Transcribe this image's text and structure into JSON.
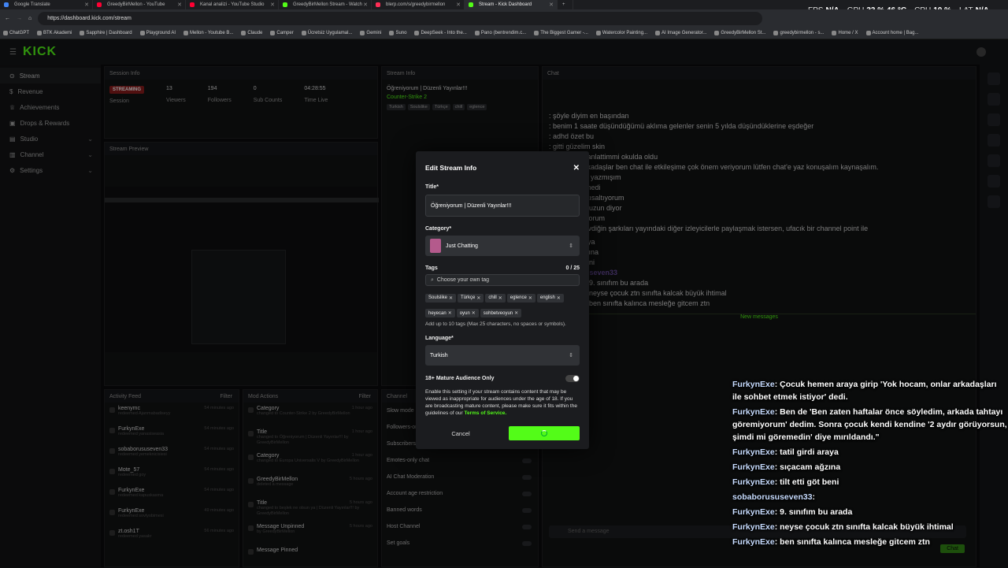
{
  "browser": {
    "tabs": [
      {
        "title": "Google Translate",
        "color": "#4285f4"
      },
      {
        "title": "GreedyBirMellon - YouTube",
        "color": "#ff0033"
      },
      {
        "title": "Kanal analizi - YouTube Studio",
        "color": "#ff0033"
      },
      {
        "title": "GreedyBirMellon Stream - Watch",
        "color": "#53fc18"
      },
      {
        "title": "blerp.com/s/greedybirmellon",
        "color": "#ff2d55"
      },
      {
        "title": "Stream - Kick Dashboard",
        "color": "#53fc18"
      }
    ],
    "url": "https://dashboard.kick.com/stream",
    "bookmarks": [
      "ChatGPT",
      "BTK Akademi",
      "Sapphire | Dashboard",
      "Playground AI",
      "Mellon - Youtube B...",
      "Claude",
      "Camper",
      "Ücretsiz Uygulamal...",
      "Gemini",
      "Suno",
      "DeepSeek - Into the...",
      "Pano (bentrendim.c...",
      "The Biggest Gamer -...",
      "Watercolor Painting...",
      "AI Image Generator...",
      "GreedyBirMellon St...",
      "greedybirmellon - s...",
      "Home / X",
      "Account home | Bag..."
    ]
  },
  "hud": {
    "fps_label": "FPS",
    "fps": "N/A",
    "gpu_label": "GPU",
    "gpu": "33 % 46 °C",
    "cpu_label": "CPU",
    "cpu": "10 %",
    "lat_label": "LAT",
    "lat": "N/A"
  },
  "sidebar": {
    "logo": "KICK",
    "items": [
      {
        "label": "Stream",
        "active": true
      },
      {
        "label": "Revenue"
      },
      {
        "label": "Achievements"
      },
      {
        "label": "Drops & Rewards"
      },
      {
        "label": "Studio",
        "expand": true
      },
      {
        "label": "Channel",
        "expand": true
      },
      {
        "label": "Settings",
        "expand": true
      }
    ]
  },
  "session": {
    "title": "Session Info",
    "status": "STREAMING",
    "viewers": "13",
    "followers": "194",
    "subs": "0",
    "time": "04:28:55",
    "labels": [
      "Session",
      "Viewers",
      "Followers",
      "Sub Counts",
      "Time Live"
    ]
  },
  "stream_info": {
    "title": "Stream Info",
    "stream_title": "Öğreniyorum | Düzenli Yayınlar!!!",
    "category": "Counter-Strike 2",
    "tags": [
      "Turkish",
      "Soulslike",
      "Türkçe",
      "chill",
      "eglence"
    ]
  },
  "preview": {
    "title": "Stream Preview"
  },
  "activity": {
    "title": "Activity Feed",
    "filter": "Filter",
    "items": [
      {
        "user": "keenymc",
        "text": "redeemed Ajanmabadiseyy",
        "time": "54 minutes ago"
      },
      {
        "user": "FurkynExe",
        "text": "redeemed yanasiseasia",
        "time": "54 minutes ago"
      },
      {
        "user": "sobaborususeven33",
        "text": "redeemed yemeknicisiesi",
        "time": "54 minutes ago"
      },
      {
        "user": "Mote_57",
        "text": "redeemed goy",
        "time": "54 minutes ago"
      },
      {
        "user": "FurkynExe",
        "text": "redeemed kapuskasma",
        "time": "54 minutes ago"
      },
      {
        "user": "FurkynExe",
        "text": "redeemed sovlyobimesi",
        "time": "49 minutes ago"
      },
      {
        "user": "zt.osh1T",
        "text": "redeemed yasakr",
        "time": "56 minutes ago"
      }
    ]
  },
  "mod_actions": {
    "title": "Mod Actions",
    "filter": "Filter",
    "items": [
      {
        "title": "Category",
        "text": "changed to Counter-Strike 2 by GreedyBirMellon",
        "time": "1 hour ago"
      },
      {
        "title": "Title",
        "text": "changed to Öğreniyorum | Düzenli Yayınlar!!! by GreedyBirMellon",
        "time": "1 hour ago"
      },
      {
        "title": "Category",
        "text": "changed to Europa Universalis V by GreedyBirMellon",
        "time": "1 hour ago"
      },
      {
        "title": "GreedyBirMellon",
        "text": "deleted a message",
        "time": "5 hours ago"
      },
      {
        "title": "Title",
        "text": "changed to beşlek ne olsun ya | Düzenli Yayınlar!!! by GreedyBirMellon",
        "time": "5 hours ago"
      },
      {
        "title": "Message Unpinned",
        "text": "by GreedyBirMellon",
        "time": "5 hours ago"
      },
      {
        "title": "Message Pinned",
        "text": "",
        "time": ""
      }
    ]
  },
  "channel": {
    "title": "Channel",
    "items": [
      "Slow mode",
      "Followers-only chat",
      "Subscribers-only chat",
      "Emotes-only chat",
      "AI Chat Moderation",
      "Account age restriction",
      "Banned words",
      "Host Channel",
      "Set goals"
    ]
  },
  "chat": {
    "title": "Chat",
    "lines": [
      {
        "user": "",
        "text": ": şöyle diyim en başından"
      },
      {
        "user": "",
        "text": ": benim 1 saate düşündüğümü aklıma gelenler senin 5 yılda düşündüklerine eşdeğer"
      },
      {
        "user": "",
        "text": ": adhd özet bu"
      },
      {
        "user": "",
        "text": ": gitti güzelim skin"
      },
      {
        "user": "",
        "text": "abi olay var anlattimmi okulda oldu"
      },
      {
        "user": "",
        "text": "x: Değerli arkadaşlar ben chat ile etkileşime çok önem veriyorum lütfen chat'e yaz konuşalım kaynaşalım."
      },
      {
        "user": "",
        "text": "abi çok uzun yazmışım"
      },
      {
        "user": "",
        "text": "kick göndermedi"
      },
      {
        "user": "",
        "text": "chat gpt de kısaltıyorum"
      },
      {
        "user": "",
        "text": "ya gene çok uzun diyor"
      },
      {
        "user": "",
        "text": "part part atıyorum"
      },
      {
        "user": "",
        "text": "x: Eğer ki sevdiğin şarkıları yayındaki diğer izleyicilerle paylaşmak istersen, ufacık bir channel point ile"
      }
    ],
    "new_messages": "New messages",
    "input_placeholder": "Send a message",
    "send": "Chat",
    "bottom_lines": [
      {
        "user": "",
        "text": "tatil girdi araya"
      },
      {
        "user": "",
        "text": "sıçacam ağzına"
      },
      {
        "user": "",
        "text": "tilt etti göt beni"
      },
      {
        "user": "sobaborususeven33",
        "text": ""
      },
      {
        "user": "FurkynExe",
        "text": ": 9. sınıfım bu arada"
      },
      {
        "user": "FurkynExe",
        "text": ": neyse çocuk ztn sınıfta kalcak büyük ihtimal"
      },
      {
        "user": "FurkynExe",
        "text": ": ben sınıfta kalınca mesleğe gitcem ztn"
      }
    ]
  },
  "modal": {
    "header": "Edit Stream Info",
    "title_label": "Title*",
    "title_value": "Öğreniyorum | Düzenli Yayınlar!!!",
    "category_label": "Category*",
    "category_value": "Just Chatting",
    "tags_label": "Tags",
    "tags_count": "0 / 25",
    "tags_placeholder": "Choose your own tag",
    "tags": [
      "Soulslike",
      "Türkçe",
      "chill",
      "eglence",
      "english",
      "heyecan",
      "oyun",
      "sohbetveoyun"
    ],
    "tags_hint": "Add up to 10 tags (Max 25 characters, no spaces or symbols).",
    "language_label": "Language*",
    "language_value": "Turkish",
    "mature_label": "18+ Mature Audience Only",
    "mature_on": false,
    "mature_desc_1": "Enable this setting if your stream contains content that may be viewed as inappropriate for audiences under the age of 18. If you are broadcasting mature content, please make sure it fits within the guidelines of our",
    "mature_link": "Terms of Service.",
    "cancel": "Cancel",
    "save": ""
  },
  "overlay": {
    "lines": [
      {
        "user": "FurkynExe",
        "text": ": Çocuk hemen araya girip 'Yok hocam, onlar arkadaşları ile sohbet etmek istiyor' dedi."
      },
      {
        "user": "FurkynExe",
        "text": ": Ben de 'Ben zaten haftalar önce söyledim, arkada tahtayı göremiyorum' dedim. Sonra çocuk kendi kendine '2 aydır görüyorsun, şimdi mi göremedin' diye mırıldandı.\""
      },
      {
        "user": "FurkynExe",
        "text": ": tatil girdi araya"
      },
      {
        "user": "FurkynExe",
        "text": ": sıçacam ağzına"
      },
      {
        "user": "FurkynExe",
        "text": ": tilt etti göt beni"
      },
      {
        "user": "sobaborususeven33",
        "text": ": "
      },
      {
        "user": "FurkynExe",
        "text": ": 9. sınıfım bu arada"
      },
      {
        "user": "FurkynExe",
        "text": ": neyse çocuk ztn sınıfta kalcak büyük ihtimal"
      },
      {
        "user": "FurkynExe",
        "text": ": ben sınıfta kalınca mesleğe gitcem ztn"
      }
    ]
  }
}
